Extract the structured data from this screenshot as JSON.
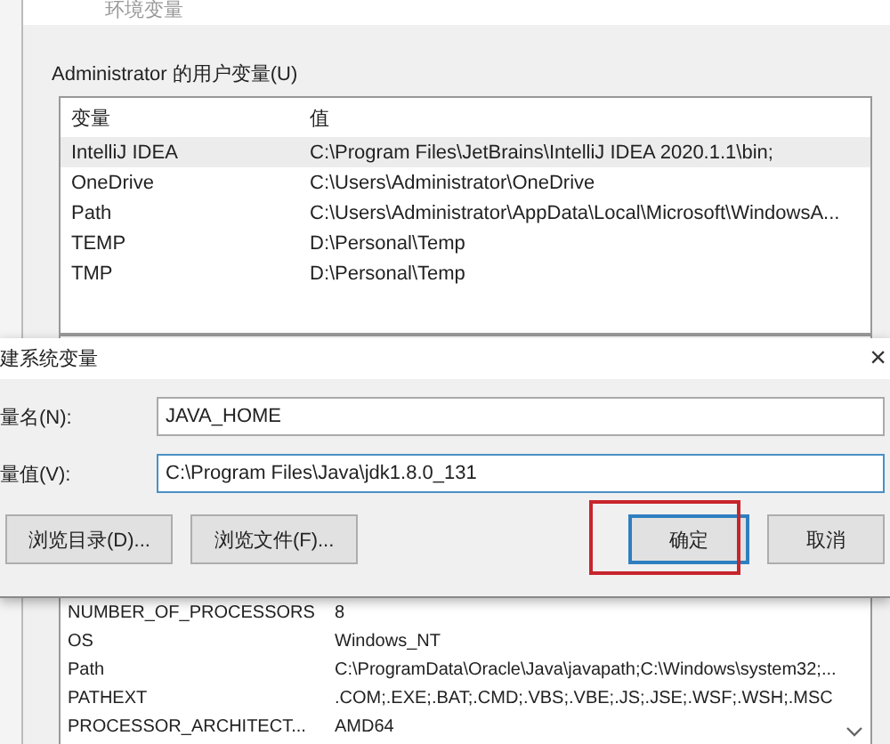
{
  "background_window": {
    "title": "环境变量",
    "user_group_label": "Administrator 的用户变量(U)",
    "user_table": {
      "columns": [
        "变量",
        "值"
      ],
      "rows": [
        {
          "name": "IntelliJ IDEA",
          "value": "C:\\Program Files\\JetBrains\\IntelliJ IDEA 2020.1.1\\bin;",
          "selected": true
        },
        {
          "name": "OneDrive",
          "value": "C:\\Users\\Administrator\\OneDrive",
          "selected": false
        },
        {
          "name": "Path",
          "value": "C:\\Users\\Administrator\\AppData\\Local\\Microsoft\\WindowsA...",
          "selected": false
        },
        {
          "name": "TEMP",
          "value": "D:\\Personal\\Temp",
          "selected": false
        },
        {
          "name": "TMP",
          "value": "D:\\Personal\\Temp",
          "selected": false
        }
      ]
    },
    "system_table": {
      "rows": [
        {
          "name": "NUMBER_OF_PROCESSORS",
          "value": "8"
        },
        {
          "name": "OS",
          "value": "Windows_NT"
        },
        {
          "name": "Path",
          "value": "C:\\ProgramData\\Oracle\\Java\\javapath;C:\\Windows\\system32;..."
        },
        {
          "name": "PATHEXT",
          "value": ".COM;.EXE;.BAT;.CMD;.VBS;.VBE;.JS;.JSE;.WSF;.WSH;.MSC"
        },
        {
          "name": "PROCESSOR_ARCHITECT...",
          "value": "AMD64"
        }
      ]
    }
  },
  "dialog": {
    "title": "建系统变量",
    "close": "×",
    "fields": [
      {
        "label": "量名(N):",
        "value": "JAVA_HOME",
        "focused": false
      },
      {
        "label": "量值(V):",
        "value": "C:\\Program Files\\Java\\jdk1.8.0_131",
        "focused": true
      }
    ],
    "buttons": [
      {
        "label": "浏览目录(D)...",
        "default": false,
        "highlighted": false
      },
      {
        "label": "浏览文件(F)...",
        "default": false,
        "highlighted": false
      },
      {
        "label": "确定",
        "default": true,
        "highlighted": true
      },
      {
        "label": "取消",
        "default": false,
        "highlighted": false
      }
    ]
  }
}
